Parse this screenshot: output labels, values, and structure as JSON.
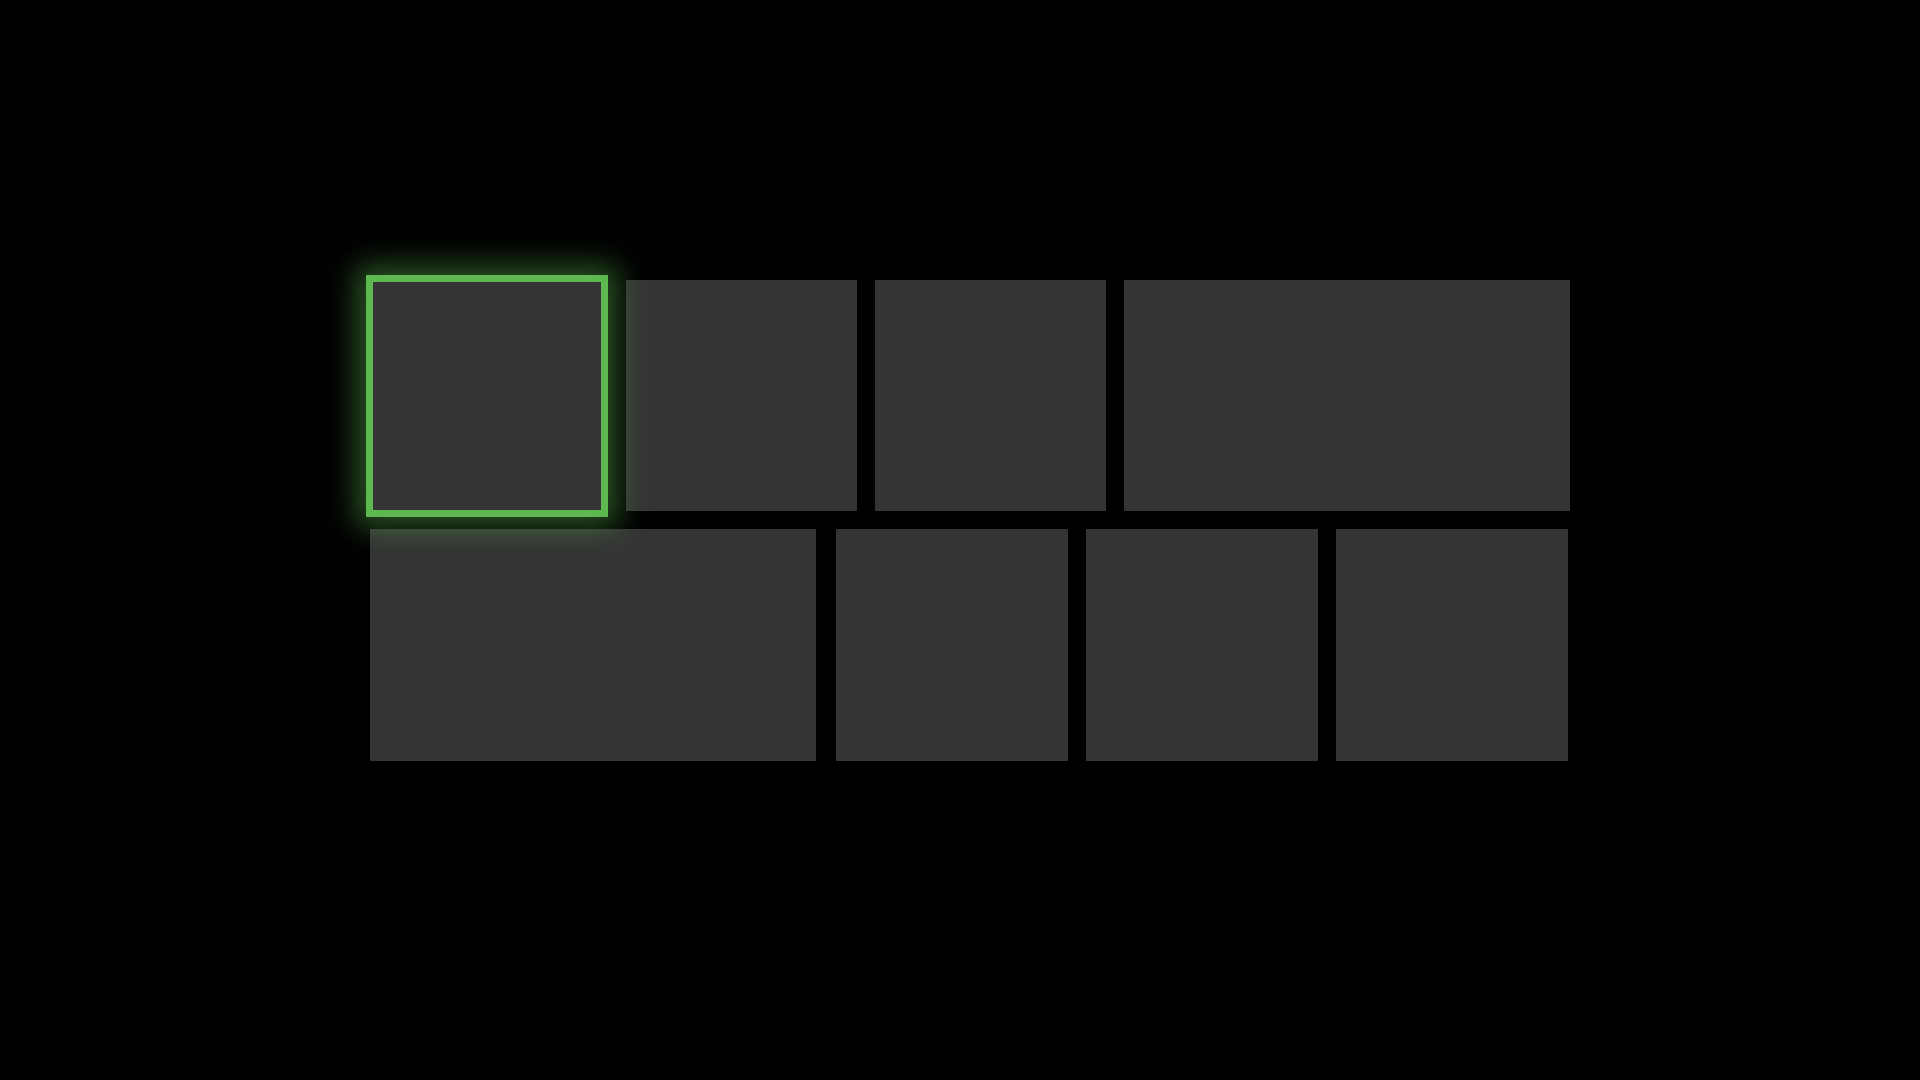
{
  "colors": {
    "background": "#000000",
    "tile": "#343434",
    "focus_accent": "#5db84f"
  },
  "grid": {
    "rows": [
      {
        "tiles": [
          {
            "id": "tile-1",
            "size": "small",
            "focused": true
          },
          {
            "id": "tile-2",
            "size": "small",
            "focused": false
          },
          {
            "id": "tile-3",
            "size": "small",
            "focused": false
          },
          {
            "id": "tile-4",
            "size": "wide",
            "focused": false
          }
        ]
      },
      {
        "tiles": [
          {
            "id": "tile-5",
            "size": "wide",
            "focused": false
          },
          {
            "id": "tile-6",
            "size": "small",
            "focused": false
          },
          {
            "id": "tile-7",
            "size": "small",
            "focused": false
          },
          {
            "id": "tile-8",
            "size": "small",
            "focused": false
          }
        ]
      }
    ]
  }
}
